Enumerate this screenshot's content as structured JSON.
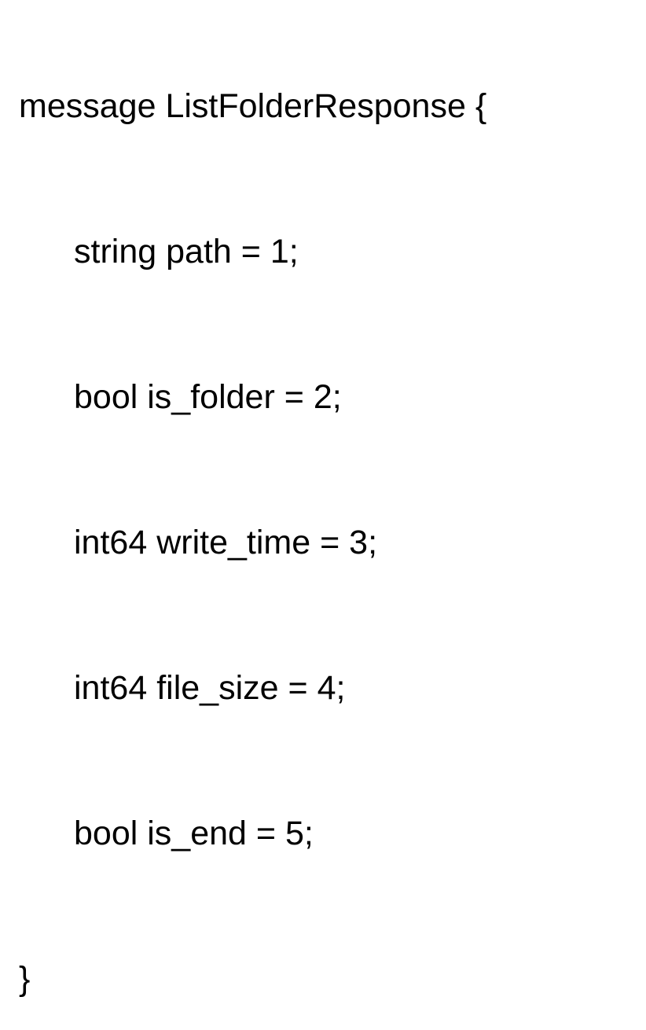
{
  "proto": {
    "keyword": "message",
    "name": "ListFolderResponse",
    "open": "{",
    "close": "}",
    "fields": [
      {
        "type": "string",
        "name": "path",
        "eq": "=",
        "num": "1",
        "semi": ";"
      },
      {
        "type": "bool",
        "name": "is_folder",
        "eq": "=",
        "num": "2",
        "semi": ";"
      },
      {
        "type": "int64",
        "name": "write_time",
        "eq": "=",
        "num": "3",
        "semi": ";"
      },
      {
        "type": "int64",
        "name": "file_size",
        "eq": "=",
        "num": "4",
        "semi": ";"
      },
      {
        "type": "bool",
        "name": "is_end",
        "eq": "=",
        "num": "5",
        "semi": ";"
      }
    ]
  }
}
